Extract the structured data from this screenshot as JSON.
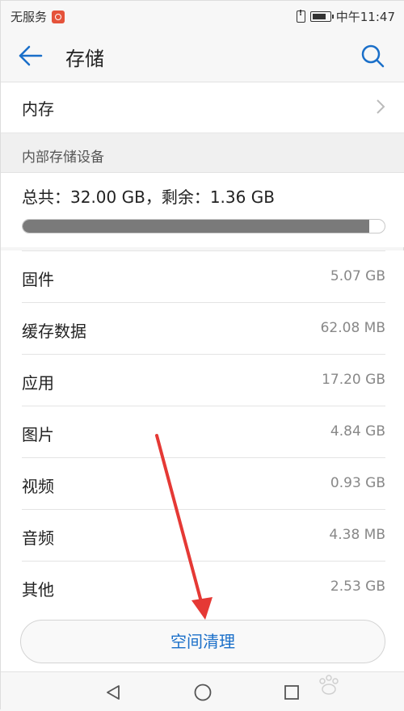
{
  "status_bar": {
    "carrier": "无服务",
    "time": "中午11:47"
  },
  "header": {
    "title": "存储",
    "back_icon": "arrow-left-icon",
    "search_icon": "search-icon",
    "accent_color": "#1a6fc9"
  },
  "internal_memory": {
    "label": "内存"
  },
  "section": {
    "title": "内部存储设备"
  },
  "summary": {
    "text": "总共：32.00 GB，剩余：1.36 GB",
    "used_fraction": 0.9575
  },
  "items": [
    {
      "name": "固件",
      "value": "5.07 GB"
    },
    {
      "name": "缓存数据",
      "value": "62.08 MB"
    },
    {
      "name": "应用",
      "value": "17.20 GB"
    },
    {
      "name": "图片",
      "value": "4.84 GB"
    },
    {
      "name": "视频",
      "value": "0.93 GB"
    },
    {
      "name": "音频",
      "value": "4.38 MB"
    },
    {
      "name": "其他",
      "value": "2.53 GB"
    }
  ],
  "clean_button": {
    "label": "空间清理"
  },
  "nav": {
    "back_icon": "triangle-back-icon",
    "home_icon": "circle-home-icon",
    "recent_icon": "square-recent-icon"
  },
  "annotation_color": "#e53935"
}
